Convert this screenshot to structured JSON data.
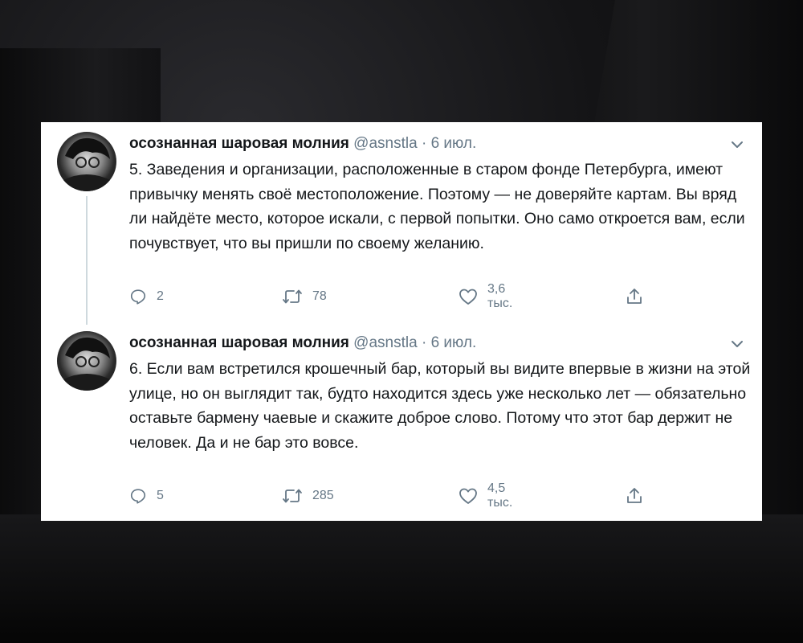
{
  "tweets": [
    {
      "name": "осознанная шаровая молния",
      "handle": "@asnstla",
      "separator": "·",
      "date": "6 июл.",
      "text": "5. Заведения и организации, расположенные в старом фонде Петербурга, имеют привычку менять своё местоположение. Поэтому — не доверяйте картам. Вы вряд ли найдёте место, которое искали, с первой попытки. Оно само откроется вам, если почувствует, что вы пришли по своему желанию.",
      "replies": "2",
      "retweets": "78",
      "likes": "3,6 тыс."
    },
    {
      "name": "осознанная шаровая молния",
      "handle": "@asnstla",
      "separator": "·",
      "date": "6 июл.",
      "text": "6. Если вам встретился крошечный бар, который вы видите впервые в жизни на этой улице, но он выглядит так, будто находится здесь уже несколько лет — обязательно оставьте бармену чаевые и скажите доброе слово. Потому что этот бар держит не человек. Да и не бар это вовсе.",
      "replies": "5",
      "retweets": "285",
      "likes": "4,5 тыс."
    }
  ],
  "icons": {
    "reply": "reply-icon",
    "retweet": "retweet-icon",
    "like": "like-icon",
    "share": "share-icon",
    "menu": "chevron-down-icon"
  },
  "colors": {
    "icon_gray": "#657786",
    "text": "#14171a",
    "card": "#ffffff",
    "thread_line": "#cfd9de"
  }
}
